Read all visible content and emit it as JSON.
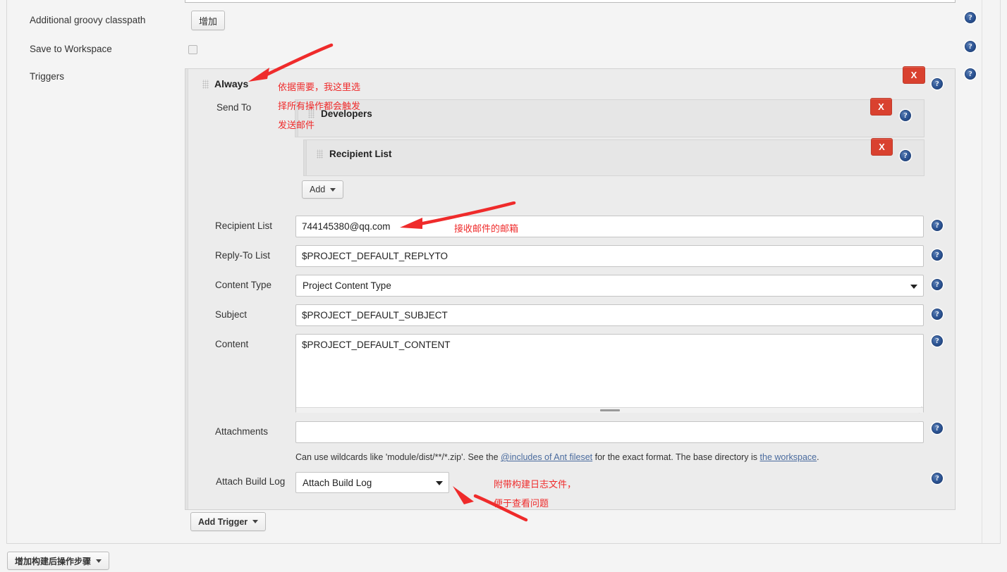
{
  "form": {
    "labels": {
      "additional_groovy_classpath": "Additional groovy classpath",
      "save_to_workspace": "Save to Workspace",
      "triggers": "Triggers",
      "send_to": "Send To",
      "recipient_list": "Recipient List",
      "reply_to_list": "Reply-To List",
      "content_type": "Content Type",
      "subject": "Subject",
      "content": "Content",
      "attachments": "Attachments",
      "attach_build_log": "Attach Build Log"
    },
    "buttons": {
      "add_classpath": "增加",
      "add": "Add",
      "add_trigger": "Add Trigger",
      "post_build_step": "增加构建后操作步骤",
      "remove": "X"
    },
    "trigger": {
      "title": "Always",
      "nested": [
        {
          "title": "Developers"
        },
        {
          "title": "Recipient List"
        }
      ]
    },
    "values": {
      "recipient_list": "744145380@qq.com",
      "reply_to_list": "$PROJECT_DEFAULT_REPLYTO",
      "content_type": "Project Content Type",
      "subject": "$PROJECT_DEFAULT_SUBJECT",
      "content": "$PROJECT_DEFAULT_CONTENT",
      "attachments": "",
      "attach_build_log": "Attach Build Log"
    },
    "hint": {
      "part1": "Can use wildcards like 'module/dist/**/*.zip'. See the ",
      "link1": "@includes of Ant fileset",
      "part2": " for the exact format. The base directory is ",
      "link2": "the workspace",
      "part3": "."
    },
    "icons": {
      "help": "help-icon",
      "drag_handle": "drag-handle-icon",
      "dropdown_caret": "chevron-down-icon"
    }
  },
  "annotations": {
    "trigger_note_line1": "依据需要，我这里选",
    "trigger_note_line2": "择所有操作都会触发",
    "trigger_note_line3": "发送邮件",
    "recipient_note": "接收邮件的邮箱",
    "attach_log_note_line1": "附带构建日志文件，",
    "attach_log_note_line2": "便于查看问题",
    "arrow_color": "#ef2b2b"
  },
  "colors": {
    "page_bg": "#f4f4f4",
    "panel_bg": "#ececec",
    "nested_bg": "#e6e6e6",
    "remove_button": "#d9412f",
    "help_icon": "#2c5494",
    "annotation": "#ef2b2b",
    "link": "#4a6b9e"
  }
}
